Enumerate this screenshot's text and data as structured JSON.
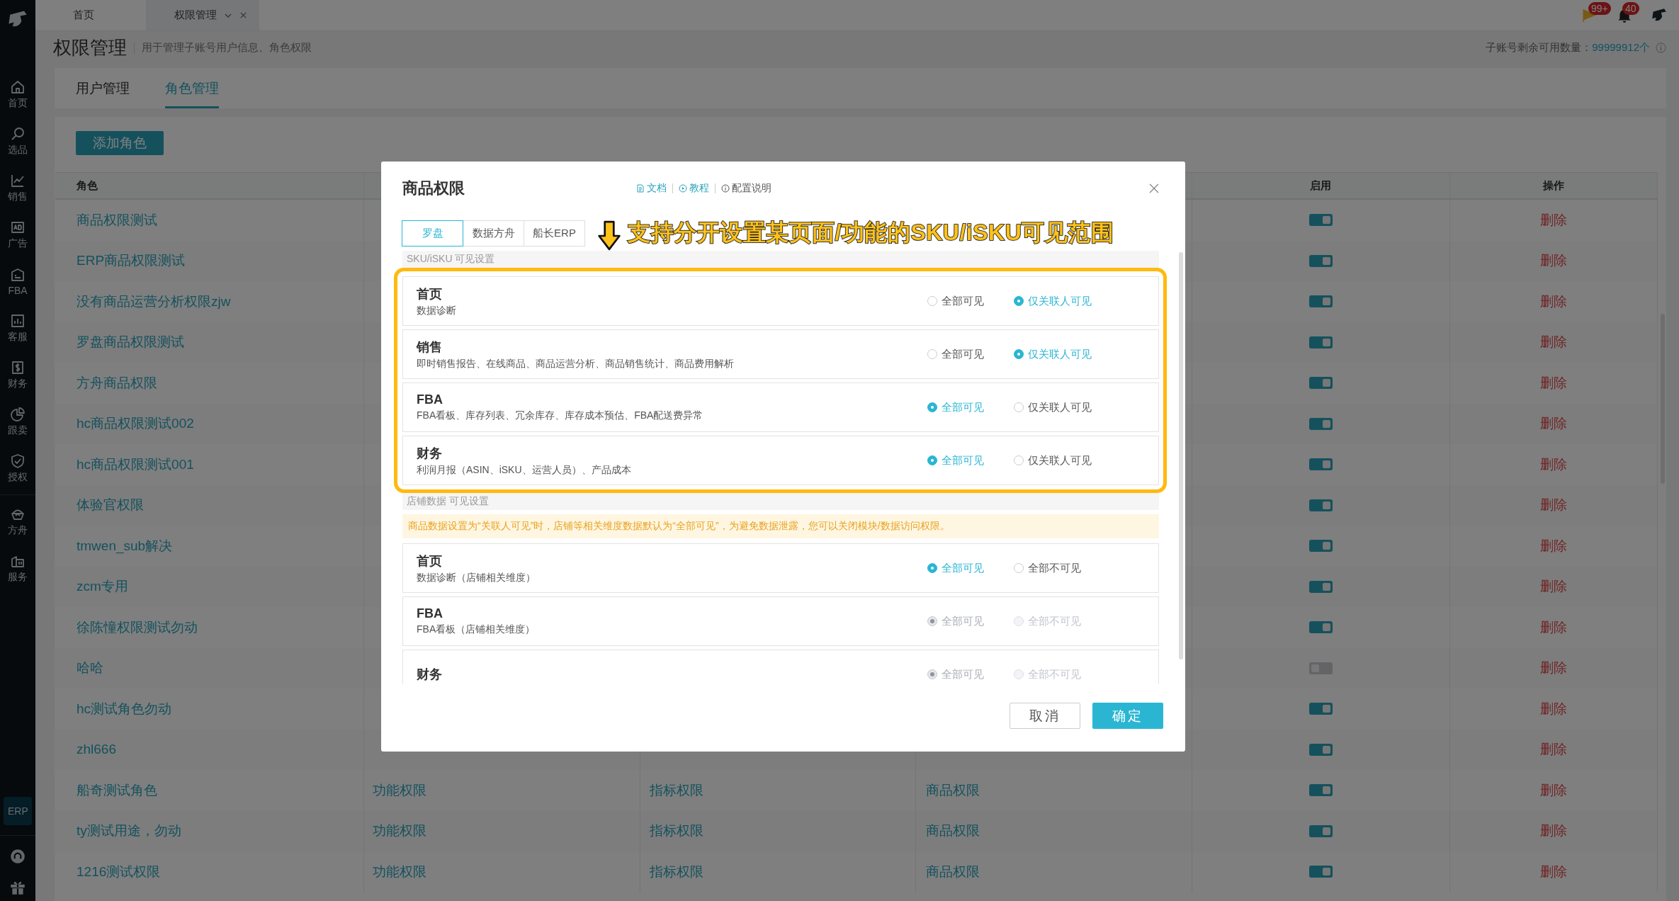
{
  "sidebar": {
    "items": [
      {
        "label": "首页"
      },
      {
        "label": "选品"
      },
      {
        "label": "销售"
      },
      {
        "label": "广告"
      },
      {
        "label": "FBA"
      },
      {
        "label": "客服"
      },
      {
        "label": "财务"
      },
      {
        "label": "跟卖"
      },
      {
        "label": "授权"
      },
      {
        "label": "方舟"
      },
      {
        "label": "服务"
      }
    ],
    "erp_badge": "ERP"
  },
  "top_tabs": [
    {
      "label": "首页",
      "selected": false,
      "closable": false
    },
    {
      "label": "权限管理",
      "selected": true,
      "closable": true
    }
  ],
  "header_icons": {
    "flag_badge": "99+",
    "bell_badge": "40"
  },
  "page": {
    "title": "权限管理",
    "subtitle": "用于管理子账号用户信息、角色权限",
    "quota_label": "子账号剩余可用数量：",
    "quota_value": "99999912个"
  },
  "sub_tabs": [
    {
      "label": "用户管理",
      "selected": false
    },
    {
      "label": "角色管理",
      "selected": true
    }
  ],
  "add_button": "添加角色",
  "table": {
    "columns": {
      "role": "角色",
      "enabled": "启用",
      "action": "操作"
    },
    "rows": [
      {
        "name": "商品权限测试",
        "enabled": true,
        "action": "删除"
      },
      {
        "name": "ERP商品权限测试",
        "enabled": true,
        "action": "删除"
      },
      {
        "name": "没有商品运营分析权限zjw",
        "enabled": true,
        "action": "删除"
      },
      {
        "name": "罗盘商品权限测试",
        "enabled": true,
        "action": "删除"
      },
      {
        "name": "方舟商品权限",
        "enabled": true,
        "action": "删除"
      },
      {
        "name": "hc商品权限测试002",
        "enabled": true,
        "action": "删除"
      },
      {
        "name": "hc商品权限测试001",
        "enabled": true,
        "action": "删除"
      },
      {
        "name": "体验官权限",
        "enabled": true,
        "action": "删除"
      },
      {
        "name": "tmwen_sub解决",
        "enabled": true,
        "action": "删除"
      },
      {
        "name": "zcm专用",
        "enabled": true,
        "action": "删除"
      },
      {
        "name": "徐陈憧权限测试勿动",
        "enabled": true,
        "action": "删除"
      },
      {
        "name": "哈哈",
        "enabled": false,
        "action": "删除"
      },
      {
        "name": "hc测试角色勿动",
        "enabled": true,
        "action": "删除"
      },
      {
        "name": "zhl666",
        "enabled": true,
        "action": "删除"
      },
      {
        "name": "船奇测试角色",
        "column_2": "功能权限",
        "column_3": "指标权限",
        "column_4": "商品权限",
        "enabled": true,
        "action": "删除"
      },
      {
        "name": "ty测试用途，勿动",
        "column_2": "功能权限",
        "column_3": "指标权限",
        "column_4": "商品权限",
        "enabled": true,
        "action": "删除"
      },
      {
        "name": "1216测试权限",
        "column_2": "功能权限",
        "column_3": "指标权限",
        "column_4": "商品权限",
        "enabled": true,
        "action": "删除"
      }
    ]
  },
  "modal": {
    "title": "商品权限",
    "links": [
      {
        "label": "文档",
        "kind": "doc"
      },
      {
        "label": "教程",
        "kind": "video"
      },
      {
        "label": "配置说明",
        "kind": "info"
      }
    ],
    "tabs": [
      {
        "label": "罗盘",
        "selected": true
      },
      {
        "label": "数据方舟",
        "selected": false
      },
      {
        "label": "船长ERP",
        "selected": false
      }
    ],
    "annotation": "支持分开设置某页面/功能的SKU/iSKU可见范围",
    "sections": [
      {
        "title": "SKU/iSKU 可见设置",
        "highlighted": true,
        "items": [
          {
            "title": "首页",
            "desc": "数据诊断",
            "disabled": false,
            "options": [
              {
                "label": "全部可见",
                "selected": false
              },
              {
                "label": "仅关联人可见",
                "selected": true
              }
            ]
          },
          {
            "title": "销售",
            "desc": "即时销售报告、在线商品、商品运营分析、商品销售统计、商品费用解析",
            "disabled": false,
            "options": [
              {
                "label": "全部可见",
                "selected": false
              },
              {
                "label": "仅关联人可见",
                "selected": true
              }
            ]
          },
          {
            "title": "FBA",
            "desc": "FBA看板、库存列表、冗余库存、库存成本预估、FBA配送费异常",
            "disabled": false,
            "options": [
              {
                "label": "全部可见",
                "selected": true
              },
              {
                "label": "仅关联人可见",
                "selected": false
              }
            ]
          },
          {
            "title": "财务",
            "desc": "利润月报（ASIN、iSKU、运营人员）、产品成本",
            "disabled": false,
            "options": [
              {
                "label": "全部可见",
                "selected": true
              },
              {
                "label": "仅关联人可见",
                "selected": false
              }
            ]
          }
        ]
      },
      {
        "title": "店铺数据 可见设置",
        "highlighted": false,
        "notice": "商品数据设置为“关联人可见”时，店铺等相关维度数据默认为“全部可见”，为避免数据泄露，您可以关闭模块/数据访问权限。",
        "items": [
          {
            "title": "首页",
            "desc": "数据诊断（店铺相关维度）",
            "disabled": false,
            "options": [
              {
                "label": "全部可见",
                "selected": true
              },
              {
                "label": "全部不可见",
                "selected": false
              }
            ]
          },
          {
            "title": "FBA",
            "desc": "FBA看板（店铺相关维度）",
            "disabled": true,
            "options": [
              {
                "label": "全部可见",
                "selected": true
              },
              {
                "label": "全部不可见",
                "selected": false
              }
            ]
          },
          {
            "title": "财务",
            "disabled": true,
            "options": [
              {
                "label": "全部可见",
                "selected": true
              },
              {
                "label": "全部不可见",
                "selected": false
              }
            ]
          }
        ]
      }
    ],
    "buttons": {
      "cancel": "取消",
      "ok": "确定"
    }
  }
}
